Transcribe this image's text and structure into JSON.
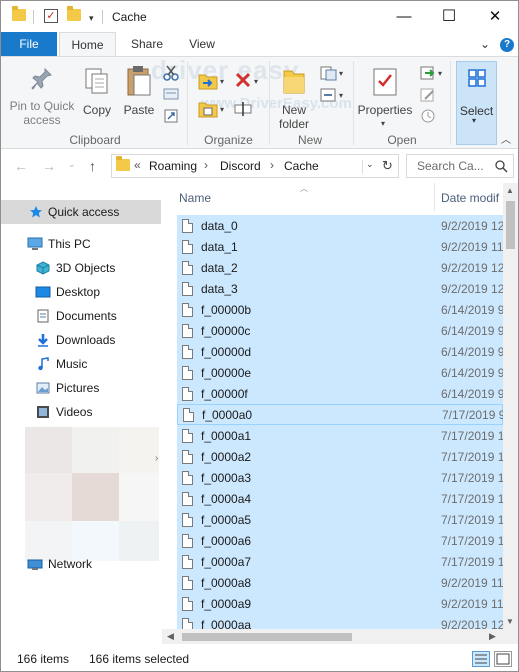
{
  "window": {
    "title": "Cache",
    "controls": {
      "minimize": "—",
      "maximize": "☐",
      "close": "✕"
    }
  },
  "ribbon_tabs": {
    "file": "File",
    "home": "Home",
    "share": "Share",
    "view": "View"
  },
  "ribbon": {
    "pin_label": "Pin to Quick access",
    "copy_label": "Copy",
    "paste_label": "Paste",
    "clipboard_group": "Clipboard",
    "organize_group": "Organize",
    "new_folder_label": "New folder",
    "new_group": "New",
    "properties_label": "Properties",
    "open_group": "Open",
    "select_label": "Select",
    "watermark": "driver easy",
    "watermark_url": "www.DriverEasy.com"
  },
  "address": {
    "prefix": "«",
    "crumbs": [
      "Roaming",
      "Discord",
      "Cache"
    ],
    "search_placeholder": "Search Ca..."
  },
  "nav": {
    "quick_access": "Quick access",
    "this_pc": "This PC",
    "items": [
      "3D Objects",
      "Desktop",
      "Documents",
      "Downloads",
      "Music",
      "Pictures",
      "Videos"
    ],
    "network": "Network"
  },
  "columns": {
    "name": "Name",
    "date": "Date modif"
  },
  "files": [
    {
      "name": "data_0",
      "date": "9/2/2019 12"
    },
    {
      "name": "data_1",
      "date": "9/2/2019 11"
    },
    {
      "name": "data_2",
      "date": "9/2/2019 12"
    },
    {
      "name": "data_3",
      "date": "9/2/2019 12"
    },
    {
      "name": "f_00000b",
      "date": "6/14/2019 9"
    },
    {
      "name": "f_00000c",
      "date": "6/14/2019 9"
    },
    {
      "name": "f_00000d",
      "date": "6/14/2019 9"
    },
    {
      "name": "f_00000e",
      "date": "6/14/2019 9"
    },
    {
      "name": "f_00000f",
      "date": "6/14/2019 9"
    },
    {
      "name": "f_0000a0",
      "date": "7/17/2019 9"
    },
    {
      "name": "f_0000a1",
      "date": "7/17/2019 1"
    },
    {
      "name": "f_0000a2",
      "date": "7/17/2019 1"
    },
    {
      "name": "f_0000a3",
      "date": "7/17/2019 1"
    },
    {
      "name": "f_0000a4",
      "date": "7/17/2019 1"
    },
    {
      "name": "f_0000a5",
      "date": "7/17/2019 1"
    },
    {
      "name": "f_0000a6",
      "date": "7/17/2019 1"
    },
    {
      "name": "f_0000a7",
      "date": "7/17/2019 1"
    },
    {
      "name": "f_0000a8",
      "date": "9/2/2019 11"
    },
    {
      "name": "f_0000a9",
      "date": "9/2/2019 11"
    },
    {
      "name": "f_0000aa",
      "date": "9/2/2019 12"
    }
  ],
  "status": {
    "count": "166 items",
    "selected": "166 items selected"
  },
  "colors": {
    "accent": "#1979ca",
    "selection": "#cce8ff",
    "folder": "#f3c947"
  }
}
